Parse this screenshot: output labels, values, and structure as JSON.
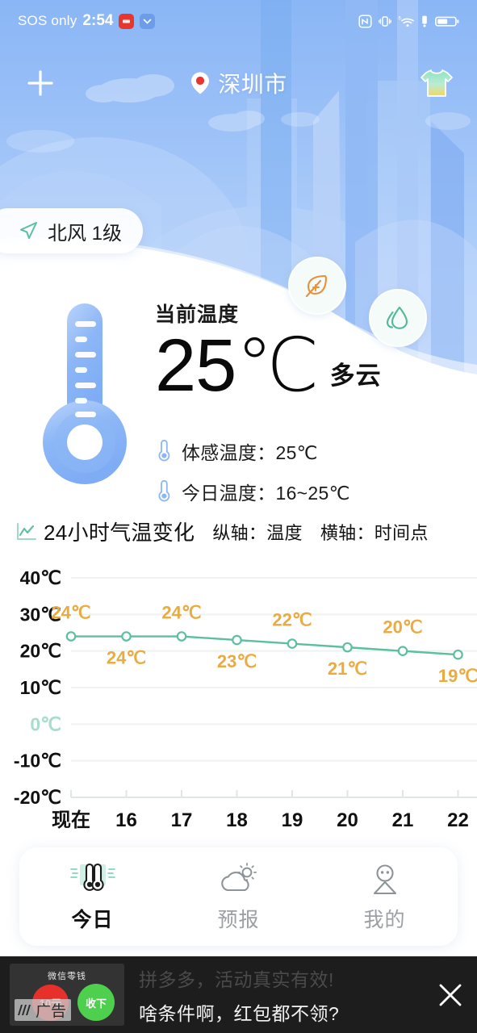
{
  "statusbar": {
    "carrier": "SOS only",
    "time": "2:54",
    "icons": [
      "nfc-icon",
      "vibrate-icon",
      "wifi-6-icon",
      "signal-alert-icon",
      "battery-icon"
    ]
  },
  "topnav": {
    "add_icon": "plus-icon",
    "location_icon": "location-pin-icon",
    "city": "深圳市",
    "clothing_icon": "tshirt-icon"
  },
  "wind": {
    "icon": "navigation-arrow-icon",
    "text": "北风 1级"
  },
  "badges": [
    {
      "name": "air-quality-badge",
      "icon": "leaf-icon",
      "color": "#e8903a"
    },
    {
      "name": "humidity-badge",
      "icon": "water-drop-icon",
      "color": "#4fb99a"
    }
  ],
  "current": {
    "label": "当前温度",
    "temperature": "25℃",
    "condition": "多云",
    "thermometer_icon": "thermometer-illustration",
    "details": [
      {
        "icon": "thermometer-small-icon",
        "text": "体感温度：25℃"
      },
      {
        "icon": "thermometer-small-icon",
        "text": "今日温度：16~25℃"
      }
    ]
  },
  "chart_header": {
    "icon": "line-chart-icon",
    "title": "24小时气温变化",
    "y_note": "纵轴：温度",
    "x_note": "横轴：时间点"
  },
  "chart_data": {
    "type": "line",
    "title": "24小时气温变化",
    "xlabel": "时间点",
    "ylabel": "温度",
    "categories": [
      "现在",
      "16",
      "17",
      "18",
      "19",
      "20",
      "21",
      "22"
    ],
    "values": [
      24,
      24,
      24,
      23,
      22,
      21,
      20,
      19
    ],
    "point_labels": [
      "24℃",
      "24℃",
      "24℃",
      "23℃",
      "22℃",
      "21℃",
      "20℃",
      "19℃"
    ],
    "label_positions": [
      "above",
      "below",
      "above",
      "below",
      "above",
      "below",
      "above",
      "below"
    ],
    "y_ticks": [
      "40℃",
      "30℃",
      "20℃",
      "10℃",
      "0℃",
      "-10℃",
      "-20℃"
    ],
    "y_tick_values": [
      40,
      30,
      20,
      10,
      0,
      -10,
      -20
    ],
    "ylim": [
      -20,
      40
    ],
    "grid": true,
    "legend": "none",
    "line_color": "#5bbfa0",
    "point_color": "#5bbfa0",
    "label_color": "#e9ab42",
    "zero_tick_color": "#a8ddcb",
    "grid_color": "#eef2f1",
    "note": "rightmost point partially clipped at screen edge"
  },
  "bottomnav": {
    "items": [
      {
        "name": "tab-today",
        "icon": "thermometers-icon",
        "label": "今日",
        "active": true
      },
      {
        "name": "tab-forecast",
        "icon": "cloud-sun-icon",
        "label": "预报",
        "active": false
      },
      {
        "name": "tab-mine",
        "icon": "person-icon",
        "label": "我的",
        "active": false
      }
    ]
  },
  "ad": {
    "thumb_title": "微信零钱",
    "coin_red": "10元",
    "coin_green": "收下",
    "tag": "广告",
    "tag_icon": "ad-bars-icon",
    "line1": "拼多多，活动真实有效!",
    "line2": "啥条件啊，红包都不领?",
    "close_icon": "close-icon"
  }
}
